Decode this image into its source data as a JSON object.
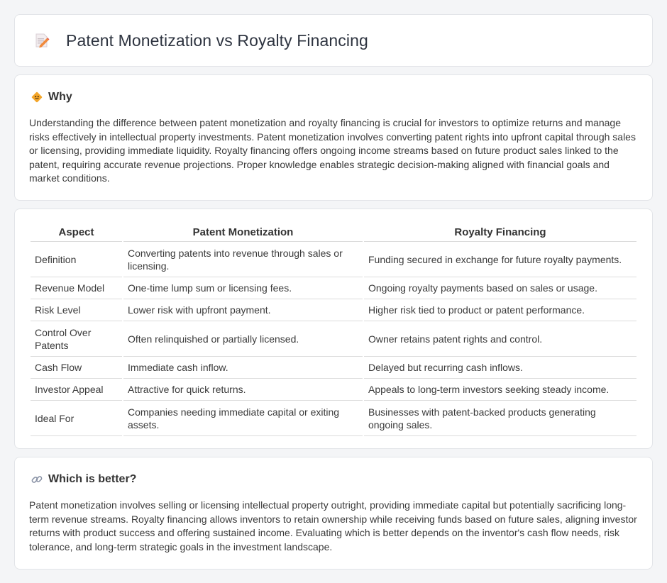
{
  "header": {
    "title": "Patent Monetization vs Royalty Financing",
    "icon": "memo-pencil-icon"
  },
  "why": {
    "heading": "Why",
    "icon": "diamond-sign-icon",
    "text": "Understanding the difference between patent monetization and royalty financing is crucial for investors to optimize returns and manage risks effectively in intellectual property investments. Patent monetization involves converting patent rights into upfront capital through sales or licensing, providing immediate liquidity. Royalty financing offers ongoing income streams based on future product sales linked to the patent, requiring accurate revenue projections. Proper knowledge enables strategic decision-making aligned with financial goals and market conditions."
  },
  "table": {
    "headers": [
      "Aspect",
      "Patent Monetization",
      "Royalty Financing"
    ],
    "rows": [
      {
        "aspect": "Definition",
        "pm": "Converting patents into revenue through sales or licensing.",
        "rf": "Funding secured in exchange for future royalty payments.",
        "tall": true
      },
      {
        "aspect": "Revenue Model",
        "pm": "One-time lump sum or licensing fees.",
        "rf": "Ongoing royalty payments based on sales or usage.",
        "tall": false
      },
      {
        "aspect": "Risk Level",
        "pm": "Lower risk with upfront payment.",
        "rf": "Higher risk tied to product or patent performance.",
        "tall": false
      },
      {
        "aspect": "Control Over Patents",
        "pm": "Often relinquished or partially licensed.",
        "rf": "Owner retains patent rights and control.",
        "tall": true
      },
      {
        "aspect": "Cash Flow",
        "pm": "Immediate cash inflow.",
        "rf": "Delayed but recurring cash inflows.",
        "tall": false
      },
      {
        "aspect": "Investor Appeal",
        "pm": "Attractive for quick returns.",
        "rf": "Appeals to long-term investors seeking steady income.",
        "tall": false
      },
      {
        "aspect": "Ideal For",
        "pm": "Companies needing immediate capital or exiting assets.",
        "rf": "Businesses with patent-backed products generating ongoing sales.",
        "tall": true
      }
    ]
  },
  "better": {
    "heading": "Which is better?",
    "icon": "link-icon",
    "text": "Patent monetization involves selling or licensing intellectual property outright, providing immediate capital but potentially sacrificing long-term revenue streams. Royalty financing allows inventors to retain ownership while receiving funds based on future sales, aligning investor returns with product success and offering sustained income. Evaluating which is better depends on the inventor's cash flow needs, risk tolerance, and long-term strategic goals in the investment landscape."
  }
}
